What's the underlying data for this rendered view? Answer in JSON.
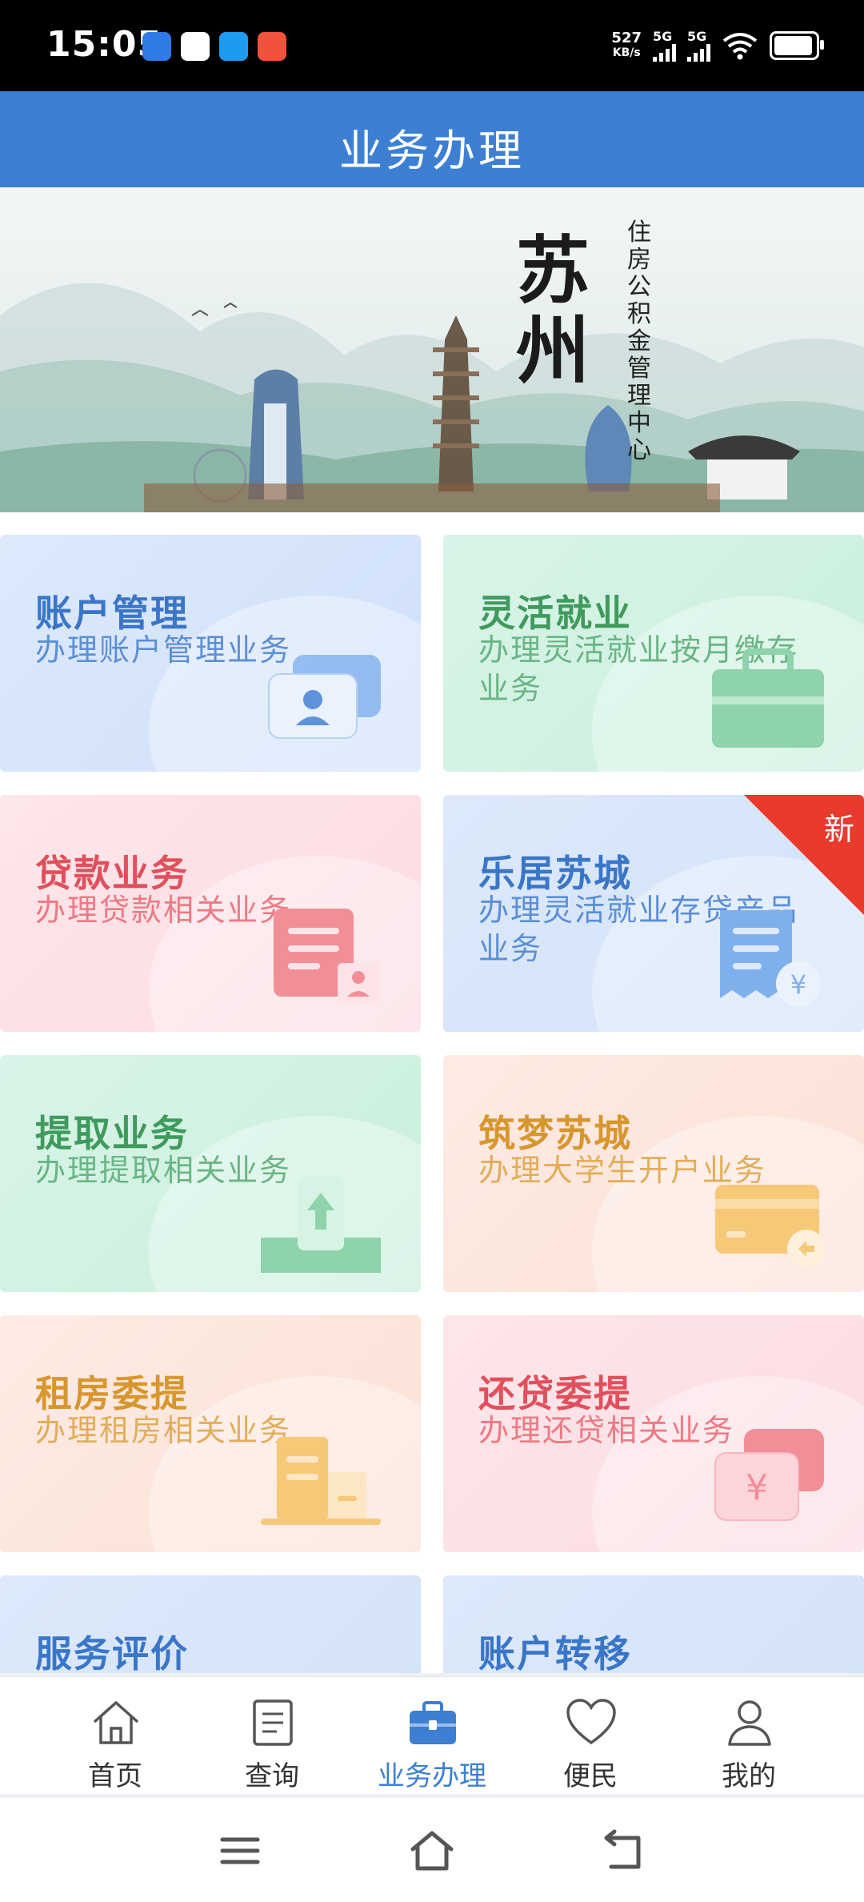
{
  "status_bar": {
    "time": "15:05",
    "net_speed_value": "527",
    "net_speed_unit": "KB/s",
    "signal1": "5G",
    "signal2": "5G"
  },
  "header": {
    "title": "业务办理"
  },
  "banner": {
    "city": "苏州",
    "org_lines": [
      "住",
      "房",
      "公",
      "积",
      "金",
      "管",
      "理",
      "中",
      "心"
    ]
  },
  "services": [
    {
      "title": "账户管理",
      "desc": "办理账户管理业务",
      "theme": "blue",
      "icon": "id-card-icon"
    },
    {
      "title": "灵活就业",
      "desc": "办理灵活就业按月缴存业务",
      "theme": "green",
      "icon": "briefcase-icon"
    },
    {
      "title": "贷款业务",
      "desc": "办理贷款相关业务",
      "theme": "pink",
      "icon": "loan-document-icon"
    },
    {
      "title": "乐居苏城",
      "desc": "办理灵活就业存贷产品业务",
      "theme": "blue",
      "icon": "receipt-yuan-icon",
      "badge": "新"
    },
    {
      "title": "提取业务",
      "desc": "办理提取相关业务",
      "theme": "green",
      "icon": "withdraw-upload-icon"
    },
    {
      "title": "筑梦苏城",
      "desc": "办理大学生开户业务",
      "theme": "orange",
      "icon": "bank-card-icon"
    },
    {
      "title": "租房委提",
      "desc": "办理租房相关业务",
      "theme": "orange",
      "icon": "rent-building-icon"
    },
    {
      "title": "还贷委提",
      "desc": "办理还贷相关业务",
      "theme": "pink",
      "icon": "yuan-wallet-icon"
    },
    {
      "title": "服务评价",
      "desc": "",
      "theme": "blue",
      "icon": ""
    },
    {
      "title": "账户转移",
      "desc": "",
      "theme": "blue",
      "icon": ""
    }
  ],
  "bottom_nav": {
    "active": "业务办理",
    "items": [
      {
        "label": "首页",
        "icon": "home-icon"
      },
      {
        "label": "查询",
        "icon": "document-list-icon"
      },
      {
        "label": "业务办理",
        "icon": "briefcase-icon"
      },
      {
        "label": "便民",
        "icon": "heart-icon"
      },
      {
        "label": "我的",
        "icon": "person-icon"
      }
    ]
  },
  "colors": {
    "primary": "#3d7fd2",
    "blue_title": "#3a76c8",
    "green_title": "#3f9a5c",
    "pink_title": "#e0505c",
    "orange_title": "#d8962f",
    "badge_red": "#e93a2c"
  }
}
